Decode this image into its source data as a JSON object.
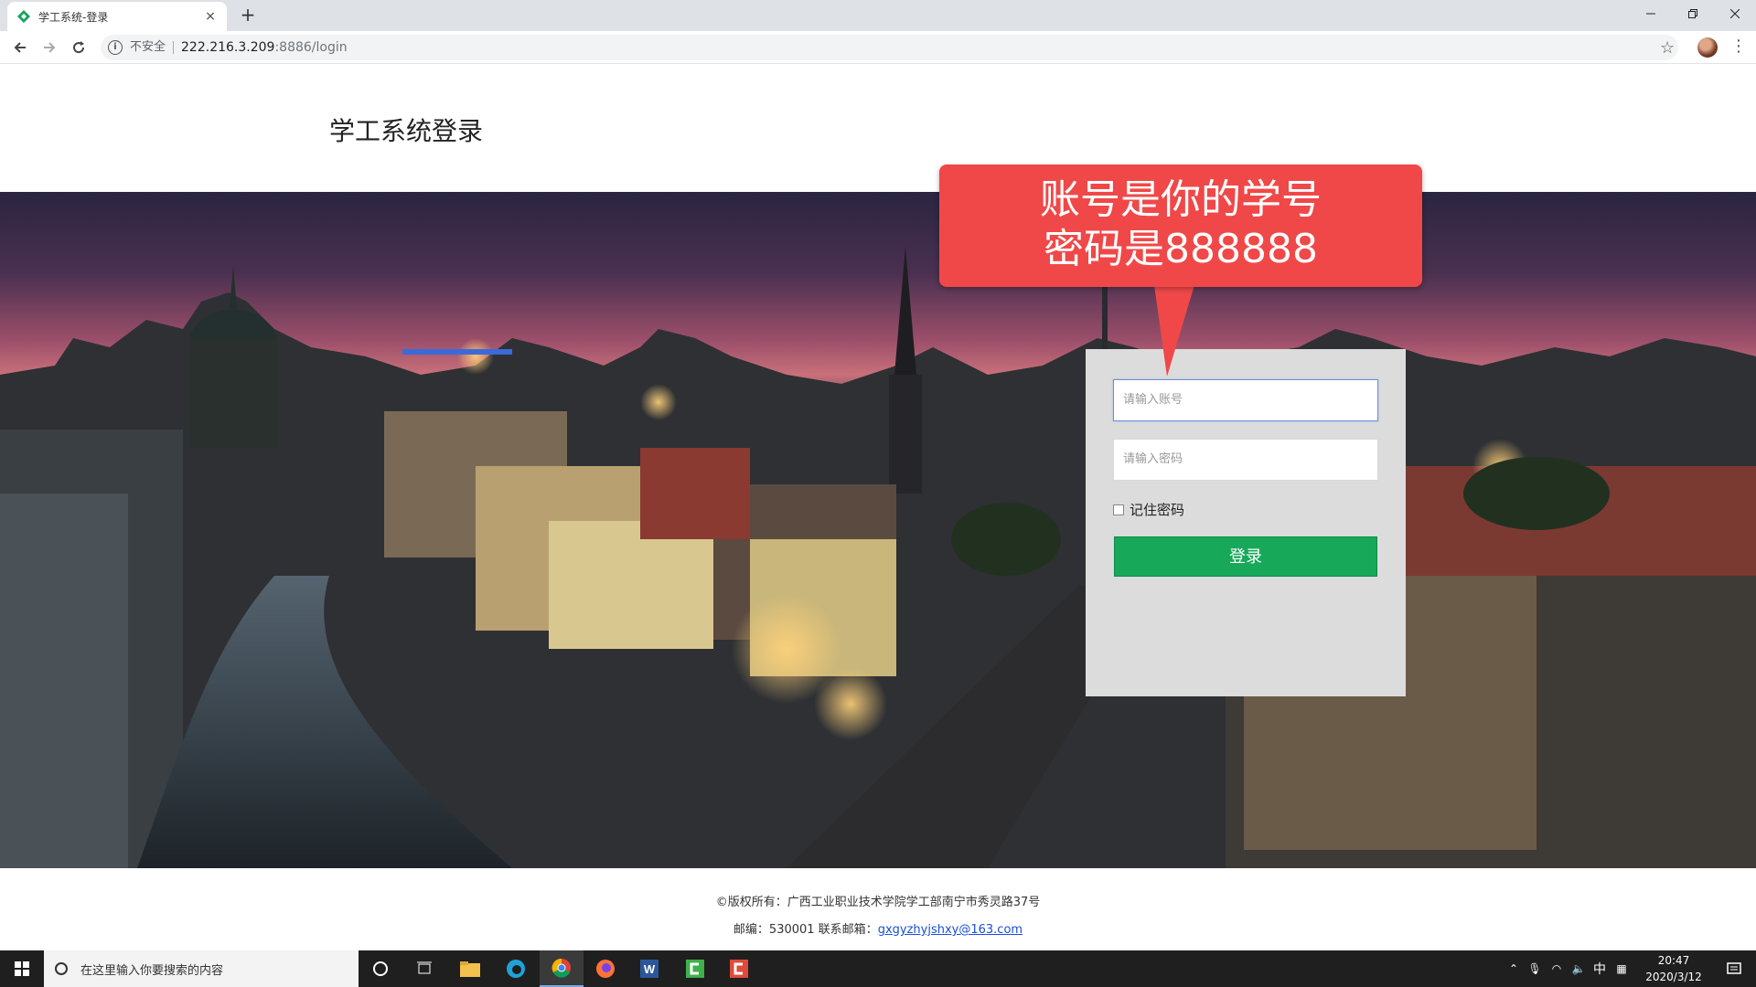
{
  "browser": {
    "tab_title": "学工系统-登录",
    "tab_close": "×",
    "new_tab": "+",
    "security_label": "不安全",
    "url_host": "222.216.3.209",
    "url_rest": ":8886/login"
  },
  "page": {
    "title": "学工系统登录"
  },
  "callout": {
    "line1": "账号是你的学号",
    "line2": "密码是888888",
    "color": "#f04848"
  },
  "login": {
    "account_placeholder": "请输入账号",
    "password_placeholder": "请输入密码",
    "remember_label": "记住密码",
    "remember_checked": false,
    "submit_label": "登录",
    "submit_color": "#17a85a"
  },
  "footer": {
    "copyright": "©版权所有：广西工业职业技术学院学工部南宁市秀灵路37号",
    "contact_prefix": "邮编：530001  联系邮箱：",
    "email": "gxgyzhyjshxy@163.com"
  },
  "taskbar": {
    "search_placeholder": "在这里输入你要搜索的内容",
    "time": "20:47",
    "date": "2020/3/12",
    "ime": "中"
  }
}
